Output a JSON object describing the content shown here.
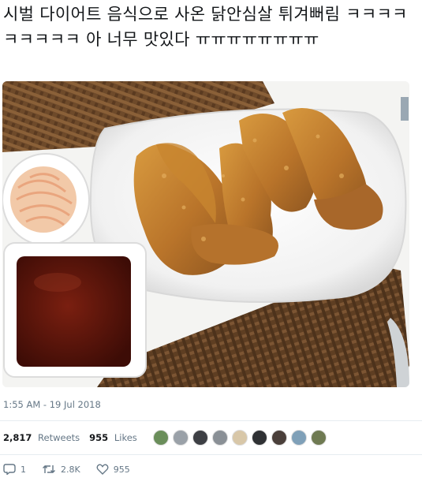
{
  "tweet": {
    "text": "시벌 다이어트 음식으로 사온 닭안심살 튀겨뻐림 ㅋㅋㅋㅋㅋㅋㅋㅋㅋ 아 너무 맛있다 ㅠㅠㅠㅠㅠㅠㅠㅠ",
    "timestamp": "1:55 AM - 19 Jul 2018"
  },
  "stats": {
    "retweets_count": "2,817",
    "retweets_label": "Retweets",
    "likes_count": "955",
    "likes_label": "Likes",
    "liker_avatars": [
      {
        "color": "#6a8e5a"
      },
      {
        "color": "#9aa1a8"
      },
      {
        "color": "#3d3f44"
      },
      {
        "color": "#8a9096"
      },
      {
        "color": "#d8c7a8"
      },
      {
        "color": "#2f3134"
      },
      {
        "color": "#4a3f3a"
      },
      {
        "color": "#7fa0b8"
      },
      {
        "color": "#6f7a52"
      }
    ]
  },
  "actions": {
    "reply_count": "1",
    "retweet_count": "2.8K",
    "like_count": "955",
    "reply_icon": "reply-icon",
    "retweet_icon": "retweet-icon",
    "like_icon": "heart-icon"
  },
  "colors": {
    "secondary_text": "#657786",
    "divider": "#e6ecf0"
  }
}
